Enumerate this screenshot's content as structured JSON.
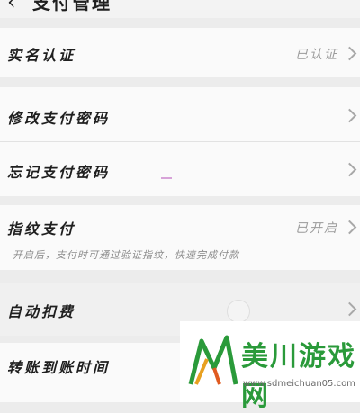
{
  "header": {
    "title": "支付管理",
    "back_icon": "chevron-left-icon"
  },
  "rows": [
    {
      "label": "实名认证",
      "value": "已认证"
    },
    {
      "label": "修改支付密码"
    },
    {
      "label": "忘记支付密码"
    },
    {
      "label": "指纹支付",
      "value": "已开启",
      "description": "开启后，支付时可通过验证指纹，快速完成付款"
    },
    {
      "label": "自动扣费"
    },
    {
      "label": "转账到账时间"
    }
  ],
  "watermark": {
    "title": "美川游戏网",
    "url": "www.sdmeichuan05.com"
  },
  "colors": {
    "watermark_green": "#2a9a3a",
    "chevron": "#a8a8a8"
  }
}
